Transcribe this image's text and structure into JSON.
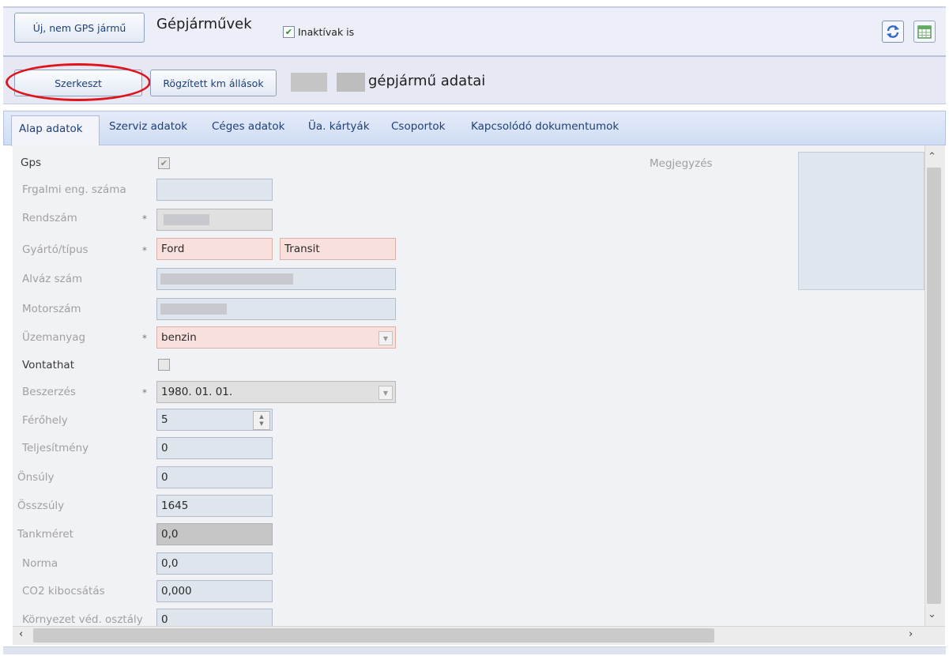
{
  "toolbar": {
    "new_vehicle_label": "Új, nem GPS jármű",
    "title": "Gépjárművek",
    "inactive_label": "Inaktívak is",
    "inactive_checked": true,
    "refresh_icon": "refresh-icon",
    "export_icon": "excel-export-icon"
  },
  "subbar": {
    "edit_label": "Szerkeszt",
    "km_label": "Rögzített km állások",
    "vehicle_heading": "gépjármű adatai"
  },
  "tabs": [
    {
      "label": "Alap adatok",
      "active": true
    },
    {
      "label": "Szerviz adatok"
    },
    {
      "label": "Céges adatok"
    },
    {
      "label": "Üa. kártyák"
    },
    {
      "label": "Csoportok"
    },
    {
      "label": "Kapcsolódó dokumentumok"
    }
  ],
  "form": {
    "gps": {
      "label": "Gps",
      "checked": true
    },
    "reg_doc": {
      "label": "Frgalmi eng. száma",
      "value": ""
    },
    "plate": {
      "label": "Rendszám",
      "required": "*"
    },
    "make_model": {
      "label": "Gyártó/típus",
      "required": "*",
      "make": "Ford",
      "model": "Transit"
    },
    "chassis": {
      "label": "Alváz szám"
    },
    "engine": {
      "label": "Motorszám"
    },
    "fuel": {
      "label": "Üzemanyag",
      "required": "*",
      "value": "benzin"
    },
    "towing": {
      "label": "Vontathat",
      "checked": false
    },
    "purchase": {
      "label": "Beszerzés",
      "required": "*",
      "value": "1980. 01. 01."
    },
    "seats": {
      "label": "Férőhely",
      "value": "5"
    },
    "power": {
      "label": "Teljesítmény",
      "value": "0"
    },
    "curb_weight": {
      "label": "Önsúly",
      "value": "0"
    },
    "gross_weight": {
      "label": "Összsúly",
      "value": "1645"
    },
    "tank": {
      "label": "Tankméret",
      "value": "0,0"
    },
    "norm": {
      "label": "Norma",
      "value": "0,0"
    },
    "co2": {
      "label": "CO2 kibocsátás",
      "value": "0,000"
    },
    "env_class": {
      "label": "Környezet véd. osztály",
      "value": "0"
    },
    "note": {
      "label": "Megjegyzés",
      "value": ""
    }
  },
  "colors": {
    "required_bg": "#f9e0dc",
    "highlight_ring": "#e0141c",
    "link_blue": "#1f3f78"
  }
}
